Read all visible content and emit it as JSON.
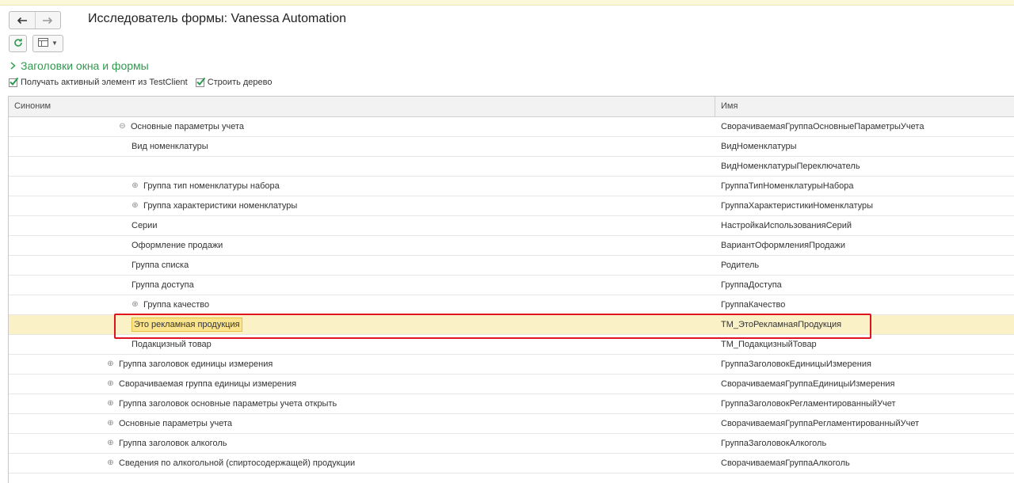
{
  "window": {
    "title": "Исследователь формы: Vanessa Automation"
  },
  "nav": {
    "back_icon": "arrow-left-icon",
    "forward_icon": "arrow-right-icon"
  },
  "toolbar": {
    "refresh_icon": "refresh-icon",
    "view_icon": "table-view-icon"
  },
  "group": {
    "label": "Заголовки окна и формы",
    "icon": "chevron-right-icon"
  },
  "options": {
    "get_active": {
      "label": "Получать активный элемент из TestClient",
      "checked": true
    },
    "build_tree": {
      "label": "Строить дерево",
      "checked": true
    }
  },
  "table": {
    "columns": {
      "synonym": "Синоним",
      "name": "Имя"
    },
    "rows": [
      {
        "synonym": "Основные параметры учета",
        "name": "СворачиваемаяГруппаОсновныеПараметрыУчета",
        "level": 1,
        "expander": "⊖"
      },
      {
        "synonym": "Вид номенклатуры",
        "name": "ВидНоменклатуры",
        "level": 2,
        "expander": ""
      },
      {
        "synonym": "",
        "name": "ВидНоменклатурыПереключатель",
        "level": 2,
        "expander": ""
      },
      {
        "synonym": "Группа тип номенклатуры набора",
        "name": "ГруппаТипНоменклатурыНабора",
        "level": 2,
        "expander": "⊕"
      },
      {
        "synonym": "Группа характеристики номенклатуры",
        "name": "ГруппаХарактеристикиНоменклатуры",
        "level": 2,
        "expander": "⊕"
      },
      {
        "synonym": "Серии",
        "name": "НастройкаИспользованияСерий",
        "level": 2,
        "expander": ""
      },
      {
        "synonym": "Оформление продажи",
        "name": "ВариантОформленияПродажи",
        "level": 2,
        "expander": ""
      },
      {
        "synonym": "Группа списка",
        "name": "Родитель",
        "level": 2,
        "expander": ""
      },
      {
        "synonym": "Группа доступа",
        "name": "ГруппаДоступа",
        "level": 2,
        "expander": ""
      },
      {
        "synonym": "Группа качество",
        "name": "ГруппаКачество",
        "level": 2,
        "expander": "⊕"
      },
      {
        "synonym": "Это рекламная продукция",
        "name": "ТМ_ЭтоРекламнаяПродукция",
        "level": 2,
        "expander": "",
        "selected": true
      },
      {
        "synonym": "Подакцизный товар",
        "name": "ТМ_ПодакцизныйТовар",
        "level": 2,
        "expander": ""
      },
      {
        "synonym": "Группа заголовок единицы измерения",
        "name": "ГруппаЗаголовокЕдиницыИзмерения",
        "level": 0,
        "expander": "⊕"
      },
      {
        "synonym": "Сворачиваемая группа единицы измерения",
        "name": "СворачиваемаяГруппаЕдиницыИзмерения",
        "level": 0,
        "expander": "⊕"
      },
      {
        "synonym": "Группа заголовок основные параметры учета открыть",
        "name": "ГруппаЗаголовокРегламентированныйУчет",
        "level": 0,
        "expander": "⊕"
      },
      {
        "synonym": "Основные параметры учета",
        "name": "СворачиваемаяГруппаРегламентированныйУчет",
        "level": 0,
        "expander": "⊕"
      },
      {
        "synonym": "Группа заголовок алкоголь",
        "name": "ГруппаЗаголовокАлкоголь",
        "level": 0,
        "expander": "⊕"
      },
      {
        "synonym": "Сведения по алкогольной (спиртосодержащей) продукции",
        "name": "СворачиваемаяГруппаАлкоголь",
        "level": 0,
        "expander": "⊕"
      }
    ]
  },
  "colors": {
    "accent_green": "#2f9a4e",
    "selection": "#fbf1c6",
    "highlight_frame": "#e0141e"
  }
}
